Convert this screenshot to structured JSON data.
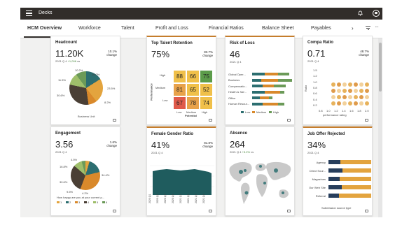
{
  "app": {
    "title": "Decks"
  },
  "tabs": [
    {
      "label": "HCM Overview"
    },
    {
      "label": "Workforce"
    },
    {
      "label": "Talent"
    },
    {
      "label": "Profit and Loss"
    },
    {
      "label": "Financial Ratios"
    },
    {
      "label": "Balance Sheet"
    },
    {
      "label": "Payables"
    }
  ],
  "icons": {
    "menu": "hamburger-icon",
    "notifications": "bell-icon",
    "user": "user-avatar-icon",
    "next": "chevron-right-icon",
    "filter": "filter-icon",
    "more": "more-horizontal-icon",
    "comment": "comment-icon"
  },
  "colors": {
    "header": "#312d2a",
    "accent": "#c57d2c",
    "teal": "#2c6e70",
    "orange": "#d9892b",
    "green": "#6b9a58",
    "navy": "#273e5c"
  },
  "cards": {
    "headcount": {
      "title": "Headcount",
      "value": "11.20K",
      "period": "2021 Q 4",
      "change": "+1,006",
      "change_note": "vs",
      "trend_pct": "10.1%",
      "trend_note": "change",
      "pie_values": [
        {
          "label": "16.0%",
          "value": 16.0,
          "color": "#2c6e70"
        },
        {
          "label": "23.5%",
          "value": 23.5,
          "color": "#e3a43e"
        },
        {
          "label": "8.2%",
          "value": 8.2,
          "color": "#d9892b"
        },
        {
          "label": "30.6%",
          "value": 30.6,
          "color": "#4a3f35"
        },
        {
          "label": "11.5%",
          "value": 11.5,
          "color": "#9fbf6b"
        },
        {
          "label": "10.2%",
          "value": 10.2,
          "color": "#6b9a58"
        }
      ],
      "footer": "Business Unit"
    },
    "talent": {
      "title": "Top Talent Retention",
      "value": "75%",
      "period": "2021 Q 4",
      "trend_pct": "83.7%",
      "trend_note": "change",
      "y_axis": "Performance",
      "x_axis": "Potential",
      "rows": [
        "High",
        "Medium",
        "Low"
      ],
      "cols": [
        "Low",
        "Medium",
        "High"
      ],
      "cells": [
        [
          88,
          66,
          75
        ],
        [
          81,
          65,
          52
        ],
        [
          67,
          78,
          74
        ]
      ]
    },
    "risk": {
      "title": "Risk of Loss",
      "value": "46",
      "period": "2021 Q 4",
      "categories": [
        "Global Oper...",
        "Business",
        "Compensatio...",
        "Health & Saf...",
        "Office",
        "Human Resour..."
      ],
      "series": [
        {
          "name": "Low",
          "color": "#2c6e70",
          "values": [
            8,
            6,
            7,
            8,
            5,
            7
          ]
        },
        {
          "name": "Medium",
          "color": "#d9892b",
          "values": [
            9,
            11,
            7,
            10,
            6,
            10
          ]
        },
        {
          "name": "High",
          "color": "#6b9a58",
          "values": [
            7,
            9,
            8,
            3,
            2,
            4
          ]
        }
      ]
    },
    "compa": {
      "title": "Compa Ratio",
      "value": "0.71",
      "period": "2021 Q 4",
      "trend_pct": "48.7%",
      "trend_note": "change",
      "y_ticks": [
        "1.5",
        "1.2",
        "1.0",
        "0.8",
        "0.6",
        "0.4",
        "0.2"
      ],
      "x_ticks": [
        "0.8",
        "1.0",
        "1.2",
        "1.4",
        "1.6",
        "1.8",
        "2.0"
      ],
      "y_axis": "Ratio",
      "x_axis": "performance rating"
    },
    "engagement": {
      "title": "Engagement",
      "value": "3.56",
      "period": "2021 Q 4",
      "trend_pct": "1.6%",
      "trend_note": "change",
      "pie_values": [
        {
          "label": "4.5%",
          "value": 4.5,
          "color": "#e3a43e"
        },
        {
          "label": "16.8%",
          "value": 16.8,
          "color": "#2c6e70"
        },
        {
          "label": "34.4%",
          "value": 34.4,
          "color": "#d9892b"
        },
        {
          "label": "30.6%",
          "value": 30.6,
          "color": "#4a3f35"
        },
        {
          "label": "9.5%",
          "value": 9.5,
          "color": "#9fbf6b"
        },
        {
          "label": "4.2%",
          "value": 4.2,
          "color": "#6b9a58"
        }
      ],
      "footer": "How happy are you at your current p...",
      "legend": [
        "1",
        "2",
        "3",
        "4",
        "5",
        "6"
      ]
    },
    "gender": {
      "title": "Female Gender Ratio",
      "value": "41%",
      "period": "2021 Q 4",
      "trend_pct": "81.8%",
      "trend_note": "change",
      "x_ticks": [
        "2020 Q1",
        "2020 Q2",
        "2020 Q3",
        "2020 Q4",
        "2021 Q1",
        "2021 Q2",
        "2021 Q3",
        "2021 Q4"
      ]
    },
    "absence": {
      "title": "Absence",
      "value": "264",
      "period": "2021 Q 4",
      "change": "+5.2%",
      "change_note": "vs",
      "trend_pct": "",
      "trend_note": ""
    },
    "offer": {
      "title": "Job Offer Rejected",
      "value": "34%",
      "period": "2021 Q 4",
      "trend_pct": "",
      "trend_note": "",
      "categories": [
        "Agency",
        "Direct Sour...",
        "Magazines",
        "Our Web Site",
        "Referral"
      ],
      "series": [
        {
          "name": "Rejected",
          "color": "#273e5c",
          "values": [
            12,
            14,
            11,
            13,
            10
          ]
        },
        {
          "name": "Accepted",
          "color": "#e3a43e",
          "values": [
            30,
            28,
            31,
            29,
            32
          ]
        }
      ],
      "x_axis": "Submission source type"
    }
  }
}
